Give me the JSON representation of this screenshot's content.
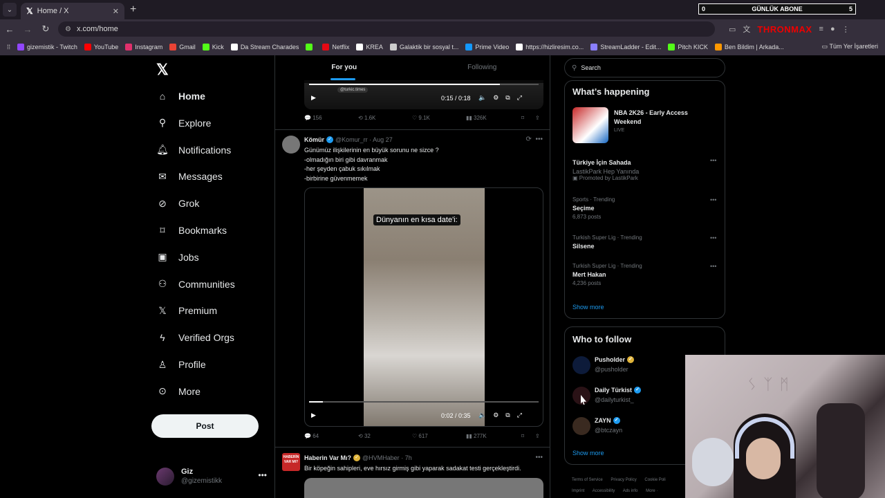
{
  "browser": {
    "tab_title": "Home / X",
    "url": "x.com/home",
    "overlay_counter": {
      "left": "0",
      "label": "GÜNLÜK ABONE",
      "right": "5"
    },
    "brand_ext": "THRONMAX",
    "bookmarks": [
      {
        "label": "gizemistik - Twitch",
        "color": "#9146ff"
      },
      {
        "label": "YouTube",
        "color": "#ff0000"
      },
      {
        "label": "Instagram",
        "color": "#e1306c"
      },
      {
        "label": "Gmail",
        "color": "#ea4335"
      },
      {
        "label": "Kick",
        "color": "#53fc18"
      },
      {
        "label": "Da Stream Charades",
        "color": "#ffffff"
      },
      {
        "label": "",
        "color": "#53fc18"
      },
      {
        "label": "Netflix",
        "color": "#e50914"
      },
      {
        "label": "KREA",
        "color": "#ffffff"
      },
      {
        "label": "Galaktik bir sosyal t...",
        "color": "#cccccc"
      },
      {
        "label": "Prime Video",
        "color": "#1399ff"
      },
      {
        "label": "https://hizliresim.co...",
        "color": "#ffffff"
      },
      {
        "label": "StreamLadder - Edit...",
        "color": "#8a7fff"
      },
      {
        "label": "Pitch KICK",
        "color": "#53fc18"
      },
      {
        "label": "Ben Bildim | Arkada...",
        "color": "#ff9800"
      }
    ],
    "bookmarks_right": "Tüm Yer İşaretleri"
  },
  "nav": {
    "items": [
      {
        "label": "Home",
        "icon": "home-icon"
      },
      {
        "label": "Explore",
        "icon": "search-icon"
      },
      {
        "label": "Notifications",
        "icon": "bell-icon"
      },
      {
        "label": "Messages",
        "icon": "mail-icon"
      },
      {
        "label": "Grok",
        "icon": "grok-icon"
      },
      {
        "label": "Bookmarks",
        "icon": "bookmark-icon"
      },
      {
        "label": "Jobs",
        "icon": "briefcase-icon"
      },
      {
        "label": "Communities",
        "icon": "people-icon"
      },
      {
        "label": "Premium",
        "icon": "x-icon"
      },
      {
        "label": "Verified Orgs",
        "icon": "lightning-icon"
      },
      {
        "label": "Profile",
        "icon": "person-icon"
      },
      {
        "label": "More",
        "icon": "more-circle-icon"
      }
    ],
    "post_label": "Post",
    "user": {
      "name": "Giz",
      "handle": "@gizemistikk"
    }
  },
  "feed": {
    "tabs": [
      "For you",
      "Following"
    ],
    "top_post": {
      "time": "0:15 / 0:18",
      "progress": 0.83,
      "tag": "@turkic.times",
      "stats": {
        "replies": "156",
        "reposts": "1.6K",
        "likes": "9.1K",
        "views": "326K"
      }
    },
    "post1": {
      "name": "Kömür",
      "handle": "@Komur_rr",
      "date": "· Aug 27",
      "lines": [
        "Günümüz ilişkilerinin en büyük sorunu ne sizce ?",
        "-olmadığın biri gibi davranmak",
        "-her şeyden çabuk sıkılmak",
        "-birbirine güvenmemek"
      ],
      "video_caption": "Dünyanın en kısa date'i:",
      "time": "0:02 / 0:35",
      "progress": 0.06,
      "stats": {
        "replies": "64",
        "reposts": "32",
        "likes": "617",
        "views": "277K"
      }
    },
    "post2": {
      "avatar_text": "HABERİN VAR MI?",
      "name": "Haberin Var Mı?",
      "handle": "@HVMHaber",
      "date": "· 7h",
      "text": "Bir köpeğin sahipleri, eve hırsız girmiş gibi yaparak sadakat testi gerçekleştirdi."
    }
  },
  "sidebar": {
    "search_placeholder": "Search",
    "happening_title": "What’s happening",
    "featured": {
      "title": "NBA 2K26 - Early Access Weekend",
      "status": "LIVE"
    },
    "promo": {
      "title": "Türkiye İçin Sahada",
      "subtitle": "LastikPark Hep Yanında",
      "promoted": "Promoted by LastikPark"
    },
    "trends": [
      {
        "context": "Sports · Trending",
        "topic": "Seçime",
        "posts": "6,873 posts"
      },
      {
        "context": "Turkish Super Lig · Trending",
        "topic": "Silsene",
        "posts": ""
      },
      {
        "context": "Turkish Super Lig · Trending",
        "topic": "Mert Hakan",
        "posts": "4,236 posts"
      }
    ],
    "show_more": "Show more",
    "follow_title": "Who to follow",
    "follow": [
      {
        "name": "Pusholder",
        "handle": "@pusholder",
        "badge": "gold"
      },
      {
        "name": "Daily Türkist",
        "handle": "@dailyturkist_",
        "badge": "blue"
      },
      {
        "name": "ZAYN",
        "handle": "@btczayn",
        "badge": "blue"
      }
    ],
    "footer": [
      "Terms of Service",
      "Privacy Policy",
      "Cookie Poli",
      "Imprint",
      "Accessibility",
      "Ads info",
      "More ·"
    ]
  }
}
